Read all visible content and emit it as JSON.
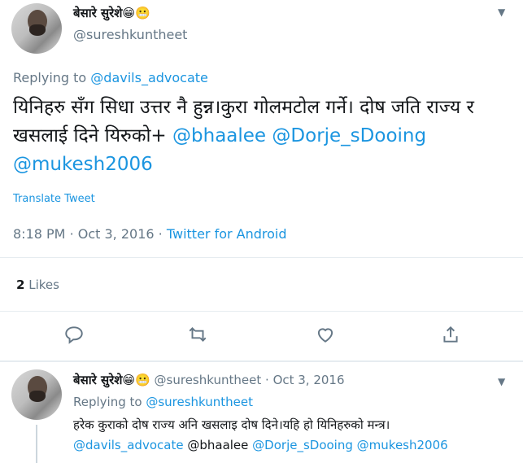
{
  "main_tweet": {
    "author_name": "बेसारे सुरेशे😁😬",
    "author_handle": "@sureshkuntheet",
    "replying_prefix": "Replying to ",
    "replying_to": "@davils_advocate",
    "text_main": "यिनिहरु सँग सिधा उत्तर नै हुन्न।कुरा गोलमटोल गर्ने। दोष जति राज्य र खसलाई दिने यिरुको+",
    "mentions": [
      "@bhaalee",
      "@Dorje_sDooing",
      "@mukesh2006"
    ],
    "translate_label": "Translate Tweet",
    "time": "8:18 PM",
    "date": "Oct 3, 2016",
    "source": "Twitter for Android",
    "likes_count": "2",
    "likes_label": "Likes"
  },
  "reply_tweet": {
    "author_name": "बेसारे सुरेशे😁😬",
    "author_handle": "@sureshkuntheet",
    "date": "Oct 3, 2016",
    "replying_prefix": "Replying to ",
    "replying_to": "@sureshkuntheet",
    "text_main": "हरेक कुराको दोष राज्य अनि खसलाइ दोष दिने।यहि हो यिनिहरुको मन्त्र।",
    "mentions": [
      "@davils_advocate",
      "@bhaalee",
      "@Dorje_sDooing",
      "@mukesh2006"
    ]
  },
  "separator": "·",
  "icons": {
    "caret": "chevron-down-icon",
    "reply": "reply-icon",
    "retweet": "retweet-icon",
    "like": "heart-icon",
    "share": "share-icon"
  },
  "colors": {
    "link": "#1b95e0",
    "muted": "#657786",
    "text": "#14171a",
    "divider": "#e6ecf0"
  }
}
